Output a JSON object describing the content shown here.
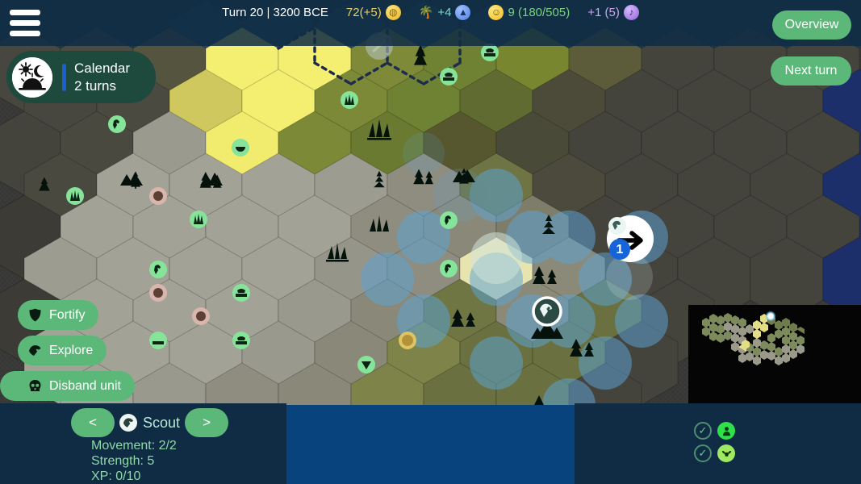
{
  "top_bar": {
    "menu_icon": "hamburger-menu-icon",
    "turn_text": "Turn 20 | 3200 BCE",
    "gold": {
      "value": "72(+5)",
      "icon": "gold-coin-icon"
    },
    "science": {
      "value": "+4",
      "icon": "science-flask-icon",
      "prefix_icon": "palm-tree-icon"
    },
    "happiness": {
      "value": "9 (180/505)",
      "icon": "happy-face-icon"
    },
    "culture": {
      "value": "+1 (5)",
      "icon": "music-note-icon"
    },
    "colors": {
      "gold": "#e8d060",
      "science": "#7fd8c8",
      "happiness": "#79d17d",
      "culture": "#c9a6ef",
      "bar_bg": "#102c44"
    }
  },
  "buttons": {
    "overview": "Overview",
    "next_turn": "Next turn",
    "accent_green": "#5cb878"
  },
  "research": {
    "name": "Calendar",
    "turns": "2 turns",
    "icon": "sun-moon-calendar-icon",
    "panel_color": "#1e4a3d",
    "progress_color": "#1a5fd0"
  },
  "unit_actions": [
    {
      "label": "Fortify",
      "icon": "shield-icon",
      "name": "fortify-button"
    },
    {
      "label": "Explore",
      "icon": "scout-bird-icon",
      "name": "explore-button"
    },
    {
      "label": "Disband unit",
      "icon": "skull-icon",
      "name": "disband-unit-button"
    }
  ],
  "selected_unit": {
    "name": "Scout",
    "icon": "scout-bird-icon",
    "prev_label": "<",
    "next_label": ">",
    "stats": [
      "Movement: 2/2",
      "Strength: 5",
      "XP: 0/10"
    ]
  },
  "turn_indicators": [
    {
      "check": "✓",
      "icon": "citizen-icon",
      "color": "#2fe04a"
    },
    {
      "check": "✓",
      "icon": "livestock-icon",
      "color": "#9fe862"
    }
  ],
  "map": {
    "movement_target": {
      "badge": "1",
      "arrow_icon": "move-arrow-icon",
      "unit_icon": "scout-bird-icon"
    },
    "selected_unit_marker": "scout-unit-marker"
  },
  "minimap": {
    "label": "minimap",
    "background": "#050505"
  }
}
